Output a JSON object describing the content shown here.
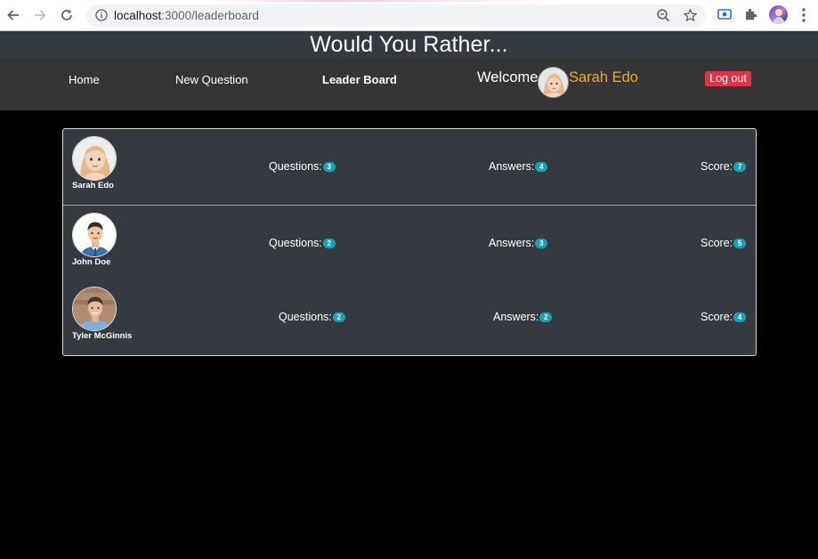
{
  "browser": {
    "url_host": "localhost",
    "url_rest": ":3000/leaderboard",
    "icons": [
      "back-icon",
      "forward-icon",
      "reload-icon",
      "info-icon",
      "zoom-icon",
      "star-icon",
      "screencast-icon",
      "puzzle-icon",
      "profile-avatar",
      "more-menu-icon"
    ]
  },
  "app": {
    "title": "Would You Rather..."
  },
  "nav": {
    "home": "Home",
    "new_question": "New Question",
    "leaderboard": "Leader Board",
    "welcome": "Welcome",
    "user_name": "Sarah Edo",
    "logout": "Log out"
  },
  "colors": {
    "header_bg": "#343a40",
    "navbar_bg": "#353535",
    "welcome_name": "#f0ad1e",
    "logout_bg": "#dc3545",
    "badge_bg": "#17a2b8"
  },
  "leaderboard": {
    "labels": {
      "questions": "Questions:",
      "answers": "Answers:",
      "score": "Score:"
    },
    "users": [
      {
        "name": "Sarah Edo",
        "avatar": "cartoon-woman-avatar",
        "questions": "3",
        "answers": "4",
        "score": "7"
      },
      {
        "name": "John Doe",
        "avatar": "man-in-suit-avatar",
        "questions": "2",
        "answers": "3",
        "score": "5"
      },
      {
        "name": "Tyler McGinnis",
        "avatar": "man-photo-avatar",
        "questions": "2",
        "answers": "2",
        "score": "4"
      }
    ]
  }
}
